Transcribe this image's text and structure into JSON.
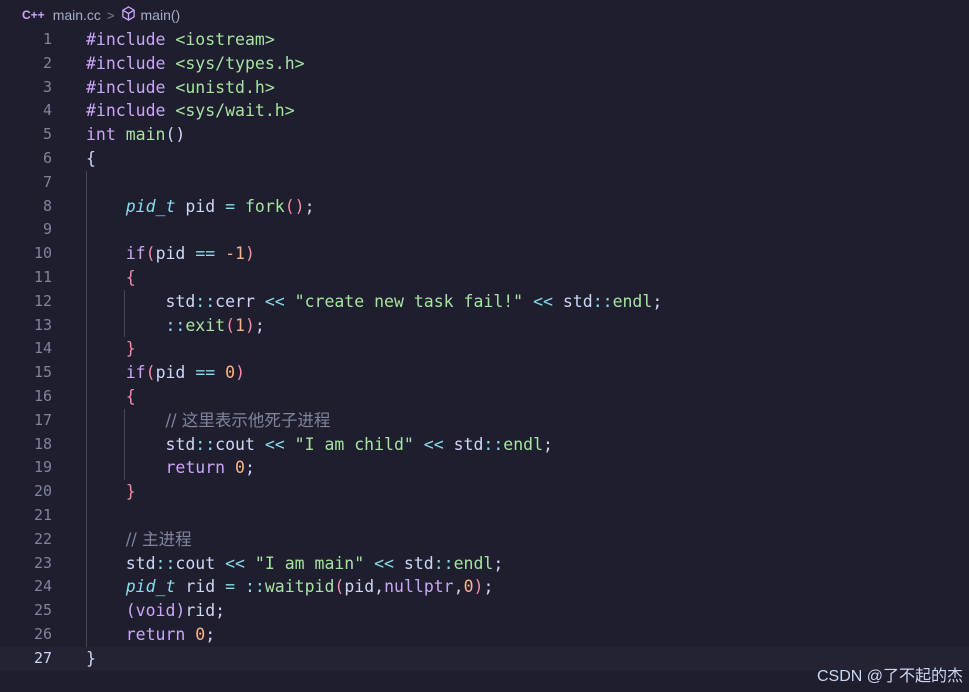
{
  "breadcrumb": {
    "lang_icon": "C++",
    "file": "main.cc",
    "separator": ">",
    "symbol": "main()"
  },
  "lines": [
    {
      "n": "1",
      "tokens": [
        [
          "#include",
          "k-pre"
        ],
        [
          " ",
          ""
        ],
        [
          "<iostream>",
          "k-inc"
        ]
      ]
    },
    {
      "n": "2",
      "tokens": [
        [
          "#include",
          "k-pre"
        ],
        [
          " ",
          ""
        ],
        [
          "<sys/types.h>",
          "k-inc"
        ]
      ]
    },
    {
      "n": "3",
      "tokens": [
        [
          "#include",
          "k-pre"
        ],
        [
          " ",
          ""
        ],
        [
          "<unistd.h>",
          "k-inc"
        ]
      ]
    },
    {
      "n": "4",
      "tokens": [
        [
          "#include",
          "k-pre"
        ],
        [
          " ",
          ""
        ],
        [
          "<sys/wait.h>",
          "k-inc"
        ]
      ]
    },
    {
      "n": "5",
      "tokens": [
        [
          "int",
          "k-type"
        ],
        [
          " ",
          ""
        ],
        [
          "main",
          "k-fn2"
        ],
        [
          "()",
          ""
        ]
      ]
    },
    {
      "n": "6",
      "tokens": [
        [
          "{",
          ""
        ]
      ]
    },
    {
      "n": "7",
      "tokens": []
    },
    {
      "n": "8",
      "tokens": [
        [
          "    ",
          ""
        ],
        [
          "pid_t",
          "k-it"
        ],
        [
          " pid ",
          ""
        ],
        [
          "=",
          "k-op"
        ],
        [
          " ",
          ""
        ],
        [
          "fork",
          "k-fn2"
        ],
        [
          "()",
          "k-br"
        ],
        [
          ";",
          ""
        ]
      ]
    },
    {
      "n": "9",
      "tokens": []
    },
    {
      "n": "10",
      "tokens": [
        [
          "    ",
          ""
        ],
        [
          "if",
          "k-kw"
        ],
        [
          "(",
          "k-br"
        ],
        [
          "pid ",
          ""
        ],
        [
          "==",
          "k-op"
        ],
        [
          " ",
          ""
        ],
        [
          "-1",
          "k-num"
        ],
        [
          ")",
          "k-br"
        ]
      ]
    },
    {
      "n": "11",
      "tokens": [
        [
          "    ",
          ""
        ],
        [
          "{",
          "k-br"
        ]
      ]
    },
    {
      "n": "12",
      "tokens": [
        [
          "        std",
          ""
        ],
        [
          "::",
          "k-op"
        ],
        [
          "cerr ",
          ""
        ],
        [
          "<<",
          "k-op"
        ],
        [
          " ",
          ""
        ],
        [
          "\"create new task fail!\"",
          "k-str"
        ],
        [
          " ",
          ""
        ],
        [
          "<<",
          "k-op"
        ],
        [
          " std",
          ""
        ],
        [
          "::",
          "k-op"
        ],
        [
          "endl",
          "k-fn2"
        ],
        [
          ";",
          ""
        ]
      ]
    },
    {
      "n": "13",
      "tokens": [
        [
          "        ",
          ""
        ],
        [
          "::",
          "k-op"
        ],
        [
          "exit",
          "k-fn2"
        ],
        [
          "(",
          "k-br"
        ],
        [
          "1",
          "k-num"
        ],
        [
          ")",
          "k-br"
        ],
        [
          ";",
          ""
        ]
      ]
    },
    {
      "n": "14",
      "tokens": [
        [
          "    ",
          ""
        ],
        [
          "}",
          "k-br"
        ]
      ]
    },
    {
      "n": "15",
      "tokens": [
        [
          "    ",
          ""
        ],
        [
          "if",
          "k-kw"
        ],
        [
          "(",
          "k-br"
        ],
        [
          "pid ",
          ""
        ],
        [
          "==",
          "k-op"
        ],
        [
          " ",
          ""
        ],
        [
          "0",
          "k-num"
        ],
        [
          ")",
          "k-br"
        ]
      ]
    },
    {
      "n": "16",
      "tokens": [
        [
          "    ",
          ""
        ],
        [
          "{",
          "k-br"
        ]
      ]
    },
    {
      "n": "17",
      "tokens": [
        [
          "        ",
          ""
        ],
        [
          "// 这里表示他死子进程",
          "k-cm"
        ]
      ]
    },
    {
      "n": "18",
      "tokens": [
        [
          "        std",
          ""
        ],
        [
          "::",
          "k-op"
        ],
        [
          "cout ",
          ""
        ],
        [
          "<<",
          "k-op"
        ],
        [
          " ",
          ""
        ],
        [
          "\"I am child\"",
          "k-str"
        ],
        [
          " ",
          ""
        ],
        [
          "<<",
          "k-op"
        ],
        [
          " std",
          ""
        ],
        [
          "::",
          "k-op"
        ],
        [
          "endl",
          "k-fn2"
        ],
        [
          ";",
          ""
        ]
      ]
    },
    {
      "n": "19",
      "tokens": [
        [
          "        ",
          ""
        ],
        [
          "return",
          "k-kw"
        ],
        [
          " ",
          ""
        ],
        [
          "0",
          "k-num"
        ],
        [
          ";",
          ""
        ]
      ]
    },
    {
      "n": "20",
      "tokens": [
        [
          "    ",
          ""
        ],
        [
          "}",
          "k-br"
        ]
      ]
    },
    {
      "n": "21",
      "tokens": []
    },
    {
      "n": "22",
      "tokens": [
        [
          "    ",
          ""
        ],
        [
          "// 主进程",
          "k-cm"
        ]
      ]
    },
    {
      "n": "23",
      "tokens": [
        [
          "    std",
          ""
        ],
        [
          "::",
          "k-op"
        ],
        [
          "cout ",
          ""
        ],
        [
          "<<",
          "k-op"
        ],
        [
          " ",
          ""
        ],
        [
          "\"I am main\"",
          "k-str"
        ],
        [
          " ",
          ""
        ],
        [
          "<<",
          "k-op"
        ],
        [
          " std",
          ""
        ],
        [
          "::",
          "k-op"
        ],
        [
          "endl",
          "k-fn2"
        ],
        [
          ";",
          ""
        ]
      ]
    },
    {
      "n": "24",
      "tokens": [
        [
          "    ",
          ""
        ],
        [
          "pid_t",
          "k-it"
        ],
        [
          " rid ",
          ""
        ],
        [
          "=",
          "k-op"
        ],
        [
          " ",
          ""
        ],
        [
          "::",
          "k-op"
        ],
        [
          "waitpid",
          "k-fn2"
        ],
        [
          "(",
          "k-br"
        ],
        [
          "pid,",
          ""
        ],
        [
          "nullptr",
          "k-kw"
        ],
        [
          ",",
          ""
        ],
        [
          "0",
          "k-num"
        ],
        [
          ")",
          "k-br"
        ],
        [
          ";",
          ""
        ]
      ]
    },
    {
      "n": "25",
      "tokens": [
        [
          "    ",
          ""
        ],
        [
          "(void)",
          "k-kw"
        ],
        [
          "rid;",
          ""
        ]
      ]
    },
    {
      "n": "26",
      "tokens": [
        [
          "    ",
          ""
        ],
        [
          "return",
          "k-kw"
        ],
        [
          " ",
          ""
        ],
        [
          "0",
          "k-num"
        ],
        [
          ";",
          ""
        ]
      ]
    },
    {
      "n": "27",
      "tokens": [
        [
          "}",
          ""
        ]
      ]
    }
  ],
  "current_line": "27",
  "watermark": "CSDN @了不起的杰"
}
